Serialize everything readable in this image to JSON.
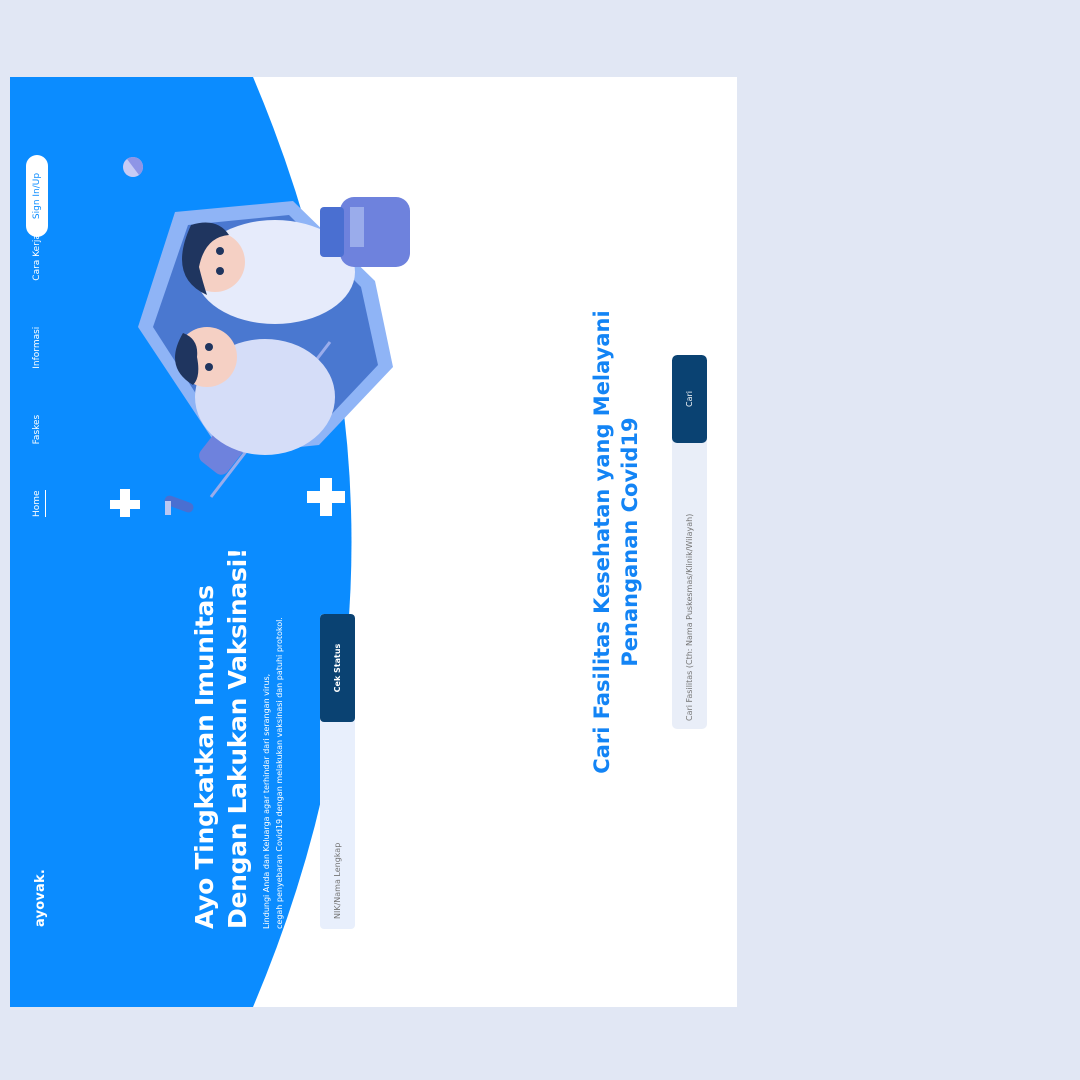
{
  "nav": {
    "logo": "ayovak.",
    "links": [
      "Home",
      "Faskes",
      "Informasi",
      "Cara Kerja"
    ],
    "signin_label": "Sign In/Up"
  },
  "hero": {
    "title_line1": "Ayo Tingkatkan Imunitas",
    "title_line2": "Dengan Lakukan Vaksinasi!",
    "desc_line1": "Lindungi Anda dan Keluarga agar terhindar dari serangan virus,",
    "desc_line2": "cegah penyebaran Covid19 dengan melakukan vaksinasi dan patuhi protokol.",
    "search_placeholder": "NIK/Nama Lengkap",
    "check_button": "Cek Status"
  },
  "facility": {
    "title_line1": "Cari Fasilitas Kesehatan yang Melayani",
    "title_line2": "Penanganan Covid19",
    "search_placeholder": "Cari Fasilitas (Cth: Nama Puskesmas/Klinik/Wilayah)",
    "search_button": "Cari"
  },
  "colors": {
    "hero_blue": "#0b8cff",
    "accent_dark": "#0a4272",
    "title_blue": "#1384f5",
    "page_bg": "#e1e7f4"
  },
  "icons": [
    "medical-cross-icon",
    "pill-icon",
    "vaccine-vial-icon",
    "syringe-icon",
    "shield-icon"
  ]
}
